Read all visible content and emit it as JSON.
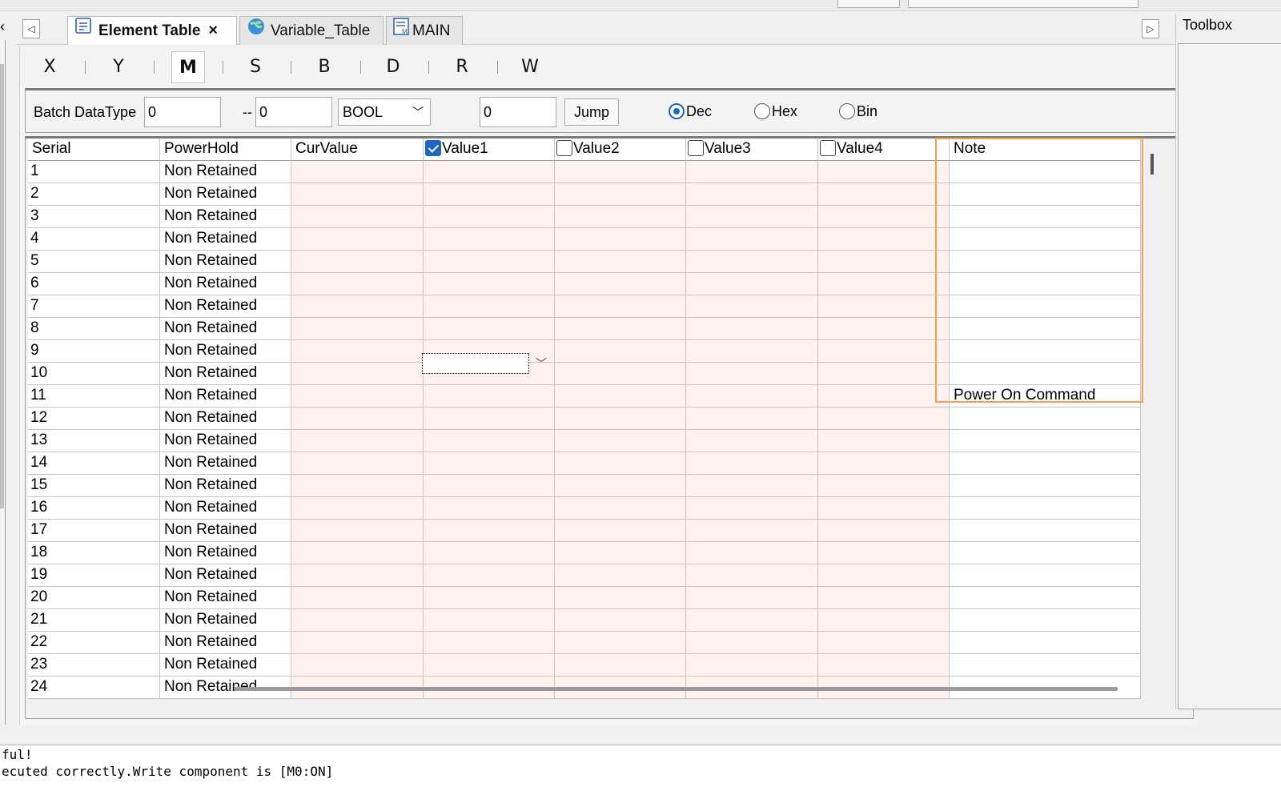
{
  "tabs": [
    {
      "label": "Element Table",
      "icon": "element-table-icon",
      "active": true,
      "closable": true
    },
    {
      "label": "Variable_Table",
      "icon": "globe-icon",
      "active": false
    },
    {
      "label": "MAIN",
      "icon": "program-icon",
      "active": false
    }
  ],
  "toolbox": {
    "title": "Toolbox"
  },
  "register_types": [
    "X",
    "Y",
    "M",
    "S",
    "B",
    "D",
    "R",
    "W"
  ],
  "active_register": "M",
  "filter": {
    "batch_label": "Batch DataType",
    "from_value": "0",
    "range_separator": "--",
    "to_value": "0",
    "datatype": "BOOL",
    "jump_value": "0",
    "jump_label": "Jump",
    "radix_options": [
      "Dec",
      "Hex",
      "Bin"
    ],
    "radix_selected": "Dec"
  },
  "table": {
    "columns": [
      "Serial",
      "PowerHold",
      "CurValue",
      "Value1",
      "Value2",
      "Value3",
      "Value4",
      "Note"
    ],
    "value1_checked": true,
    "value2_checked": false,
    "value3_checked": false,
    "value4_checked": false,
    "rows": [
      {
        "serial": "1",
        "powerhold": "Non Retained",
        "note": ""
      },
      {
        "serial": "2",
        "powerhold": "Non Retained",
        "note": ""
      },
      {
        "serial": "3",
        "powerhold": "Non Retained",
        "note": ""
      },
      {
        "serial": "4",
        "powerhold": "Non Retained",
        "note": ""
      },
      {
        "serial": "5",
        "powerhold": "Non Retained",
        "note": ""
      },
      {
        "serial": "6",
        "powerhold": "Non Retained",
        "note": ""
      },
      {
        "serial": "7",
        "powerhold": "Non Retained",
        "note": ""
      },
      {
        "serial": "8",
        "powerhold": "Non Retained",
        "note": ""
      },
      {
        "serial": "9",
        "powerhold": "Non Retained",
        "note": ""
      },
      {
        "serial": "10",
        "powerhold": "Non Retained",
        "note": ""
      },
      {
        "serial": "11",
        "powerhold": "Non Retained",
        "note": "Power On Command"
      },
      {
        "serial": "12",
        "powerhold": "Non Retained",
        "note": ""
      },
      {
        "serial": "13",
        "powerhold": "Non Retained",
        "note": ""
      },
      {
        "serial": "14",
        "powerhold": "Non Retained",
        "note": ""
      },
      {
        "serial": "15",
        "powerhold": "Non Retained",
        "note": ""
      },
      {
        "serial": "16",
        "powerhold": "Non Retained",
        "note": ""
      },
      {
        "serial": "17",
        "powerhold": "Non Retained",
        "note": ""
      },
      {
        "serial": "18",
        "powerhold": "Non Retained",
        "note": ""
      },
      {
        "serial": "19",
        "powerhold": "Non Retained",
        "note": ""
      },
      {
        "serial": "20",
        "powerhold": "Non Retained",
        "note": ""
      },
      {
        "serial": "21",
        "powerhold": "Non Retained",
        "note": ""
      },
      {
        "serial": "22",
        "powerhold": "Non Retained",
        "note": ""
      },
      {
        "serial": "23",
        "powerhold": "Non Retained",
        "note": ""
      },
      {
        "serial": "24",
        "powerhold": "Non Retained",
        "note": ""
      }
    ]
  },
  "output": {
    "lines": [
      "ful!",
      "ecuted correctly.Write component is [M0:ON]"
    ]
  },
  "colors": {
    "value_cell_bg": "#fff1ee",
    "highlight_border": "#f4a050",
    "accent_blue": "#1f66c4"
  }
}
